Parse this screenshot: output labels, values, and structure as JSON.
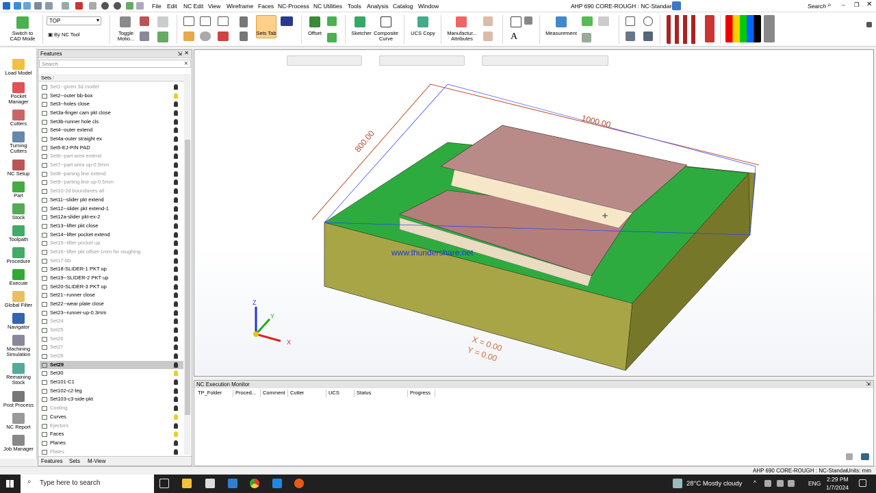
{
  "menu": {
    "items": [
      "File",
      "Edit",
      "NC Edit",
      "View",
      "Wireframe",
      "Faces",
      "NC-Process",
      "NC Utilities",
      "Tools",
      "Analysis",
      "Catalog",
      "Window"
    ],
    "title": "AHP 690 CORE-ROUGH : NC-Standard",
    "search": "Search"
  },
  "ribbon": {
    "switch_cad": "Switch to\nCAD Mode",
    "view_select": "TOP",
    "by_nc_tool": "By NC Tool",
    "toggle_motion": "Toggle\nMotio...",
    "sets_tab": "Sets Tab",
    "offset": "Offset",
    "sketcher": "Sketcher",
    "composite_curve": "Composite\nCurve",
    "ucs_copy": "UCS Copy",
    "manufacturing_attributes": "Manufactur...\nAttributes",
    "measurement": "Measurement"
  },
  "leftbar": {
    "items": [
      "Load Model",
      "Pocket\nManager",
      "Cutters",
      "Turning\nCutters",
      "NC Setup",
      "Part",
      "Stock",
      "Toolpath",
      "Procedure",
      "Execute",
      "Global Filter",
      "Navigator",
      "Machining\nSimulation",
      "Remaining\nStock",
      "Post Process",
      "NC Report",
      "Job Manager"
    ]
  },
  "features": {
    "title": "Features",
    "search_placeholder": "Search",
    "column_header": "Sets",
    "rows": [
      {
        "label": "Set1--given 3d model",
        "dim": true,
        "bulb": "dark"
      },
      {
        "label": "Set2--outer bb-box",
        "dim": false,
        "bulb": "yellow"
      },
      {
        "label": "Set3--holes close",
        "dim": false,
        "bulb": "dark"
      },
      {
        "label": "Set3a-finger cam pkt close",
        "dim": false,
        "bulb": "dark"
      },
      {
        "label": "Set3b-runner hole cls",
        "dim": false,
        "bulb": "dark"
      },
      {
        "label": "Set4--outer extend",
        "dim": false,
        "bulb": "dark"
      },
      {
        "label": "Set4a-outer straight ex",
        "dim": false,
        "bulb": "dark"
      },
      {
        "label": "Set5-EJ-PIN PAD",
        "dim": false,
        "bulb": "dark"
      },
      {
        "label": "Set6--part area extend",
        "dim": true,
        "bulb": "dark"
      },
      {
        "label": "Set7--part area up-0.5mm",
        "dim": true,
        "bulb": "dark"
      },
      {
        "label": "Set8--parting line extend",
        "dim": true,
        "bulb": "dark"
      },
      {
        "label": "Set9--parting line up-0.5mm",
        "dim": true,
        "bulb": "dark"
      },
      {
        "label": "Set10-2d boundaries all",
        "dim": true,
        "bulb": "dark"
      },
      {
        "label": "Set11--slider pkt extend",
        "dim": false,
        "bulb": "dark"
      },
      {
        "label": "Set12--slider pkt extend-1",
        "dim": false,
        "bulb": "dark"
      },
      {
        "label": "Set12a-slider pkt-ex-2",
        "dim": false,
        "bulb": "dark"
      },
      {
        "label": "Set13--lifter pkt close",
        "dim": false,
        "bulb": "dark"
      },
      {
        "label": "Set14--lifter pocket extend",
        "dim": false,
        "bulb": "dark"
      },
      {
        "label": "Set15--lifter pocket up",
        "dim": true,
        "bulb": "dark"
      },
      {
        "label": "Set16--lifter pkt offset-1mm for roughing",
        "dim": true,
        "bulb": "dark"
      },
      {
        "label": "Set17-bb",
        "dim": true,
        "bulb": "dark"
      },
      {
        "label": "Set18-SLIDER-1 PKT up",
        "dim": false,
        "bulb": "dark"
      },
      {
        "label": "Set19--SLIDER-2 PKT up",
        "dim": false,
        "bulb": "dark"
      },
      {
        "label": "Set20-SLIDER-3 PKT up",
        "dim": false,
        "bulb": "dark"
      },
      {
        "label": "Set21--runner close",
        "dim": false,
        "bulb": "dark"
      },
      {
        "label": "Set22--wear plate close",
        "dim": false,
        "bulb": "dark"
      },
      {
        "label": "Set23--runner-up-0.3mm",
        "dim": false,
        "bulb": "dark"
      },
      {
        "label": "Set24",
        "dim": true,
        "bulb": "dark"
      },
      {
        "label": "Set25",
        "dim": true,
        "bulb": "dark"
      },
      {
        "label": "Set26",
        "dim": true,
        "bulb": "dark"
      },
      {
        "label": "Set27",
        "dim": true,
        "bulb": "dark"
      },
      {
        "label": "Set28",
        "dim": true,
        "bulb": "dark"
      },
      {
        "label": "Set29",
        "dim": false,
        "bulb": "dark",
        "selected": true
      },
      {
        "label": "Set30",
        "dim": false,
        "bulb": "yellow"
      },
      {
        "label": "Set101-C1",
        "dim": false,
        "bulb": "dark"
      },
      {
        "label": "Set102-c2-leg",
        "dim": false,
        "bulb": "dark"
      },
      {
        "label": "Set103-c3-side-pkt",
        "dim": false,
        "bulb": "dark"
      },
      {
        "label": "Cooling",
        "dim": true,
        "bulb": "dark"
      },
      {
        "label": "Curves",
        "dim": false,
        "bulb": "yellow"
      },
      {
        "label": "Ejectors",
        "dim": true,
        "bulb": "dark"
      },
      {
        "label": "Faces",
        "dim": false,
        "bulb": "yellow"
      },
      {
        "label": "Planes",
        "dim": false,
        "bulb": "dark"
      },
      {
        "label": "Plates",
        "dim": true,
        "bulb": "dark"
      }
    ],
    "tabs": [
      "Features",
      "Sets",
      "M-View"
    ]
  },
  "viewport": {
    "dim_x": "1000.00",
    "dim_y": "800.00",
    "watermark": "www.thundershare.net",
    "ucs_x": "X = 0.00",
    "ucs_y": "Y = 0.00",
    "axis_x": "X",
    "axis_y": "Y",
    "axis_z": "Z"
  },
  "ncmonitor": {
    "title": "NC Execution Monitor",
    "columns": [
      "TP_Folder",
      "Proced...",
      "Comment",
      "Cutter",
      "UCS",
      "Status",
      "Progress"
    ]
  },
  "statusbar": {
    "doc": "AHP 690 CORE-ROUGH : NC-Standar",
    "units": "Units: mm"
  },
  "taskbar": {
    "search_placeholder": "Type here to search",
    "weather": "28°C  Mostly cloudy",
    "lang": "ENG",
    "time": "2:29 PM",
    "date": "1/7/2024"
  }
}
